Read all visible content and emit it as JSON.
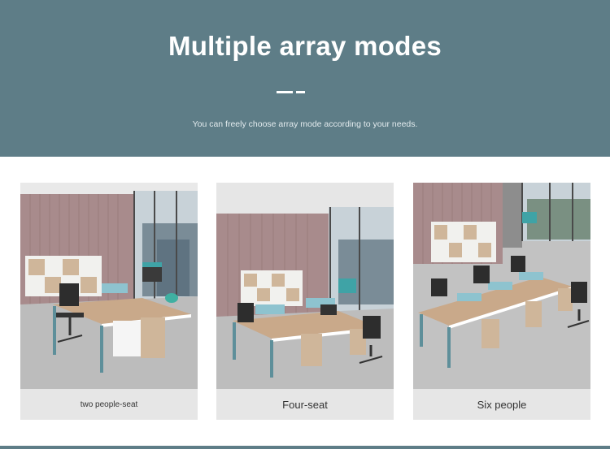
{
  "banner": {
    "title": "Multiple array modes",
    "subtitle": "You can freely choose array mode according to your needs."
  },
  "cards": [
    {
      "caption": "two people-seat",
      "photo": "two-person-workstation-photo"
    },
    {
      "caption": "Four-seat",
      "photo": "four-person-workstation-photo"
    },
    {
      "caption": "Six people",
      "photo": "six-person-workstation-photo"
    }
  ],
  "colors": {
    "banner": "#5e7d87",
    "card": "#e6e6e6",
    "wall": "#a88b8c",
    "desk": "#c9a98a",
    "partition": "#8ec3cf"
  }
}
